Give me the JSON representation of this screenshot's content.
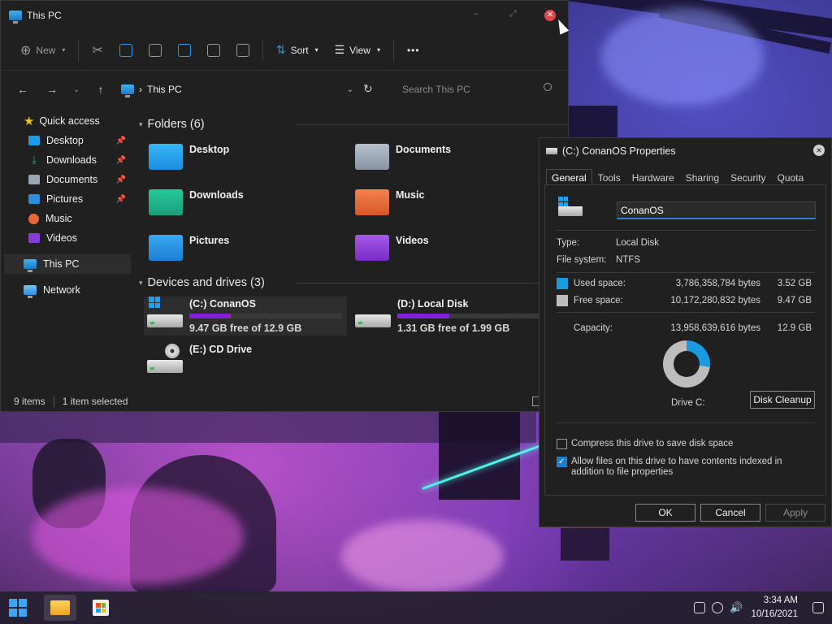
{
  "explorer": {
    "title": "This PC",
    "toolbar": {
      "new_label": "New",
      "sort_label": "Sort",
      "view_label": "View",
      "more_label": "•••"
    },
    "address": {
      "path": "This PC",
      "separator": "›"
    },
    "search": {
      "placeholder": "Search This PC"
    },
    "sidebar": {
      "quick_access": "Quick access",
      "items": [
        {
          "label": "Desktop",
          "icon": "desktop-folder-icon",
          "pinned": true
        },
        {
          "label": "Downloads",
          "icon": "downloads-folder-icon",
          "pinned": true
        },
        {
          "label": "Documents",
          "icon": "documents-folder-icon",
          "pinned": true
        },
        {
          "label": "Pictures",
          "icon": "pictures-folder-icon",
          "pinned": true
        },
        {
          "label": "Music",
          "icon": "music-folder-icon",
          "pinned": false
        },
        {
          "label": "Videos",
          "icon": "videos-folder-icon",
          "pinned": false
        }
      ],
      "this_pc": "This PC",
      "network": "Network"
    },
    "folders_header": "Folders (6)",
    "folders": [
      {
        "label": "Desktop",
        "color": "#1e9be8"
      },
      {
        "label": "Documents",
        "color": "#9aa6b4"
      },
      {
        "label": "Downloads",
        "color": "#1db38a"
      },
      {
        "label": "Music",
        "color": "#e8683a"
      },
      {
        "label": "Pictures",
        "color": "#2a8fe0"
      },
      {
        "label": "Videos",
        "color": "#8a3ad6"
      }
    ],
    "drives_header": "Devices and drives (3)",
    "drives": [
      {
        "name": "(C:) ConanOS",
        "free": "9.47 GB free of 12.9 GB",
        "used_fraction": 0.27
      },
      {
        "name": "(D:) Local Disk",
        "free": "1.31 GB free of 1.99 GB",
        "used_fraction": 0.34
      },
      {
        "name": "(E:) CD Drive",
        "free": "",
        "used_fraction": null
      }
    ],
    "status": {
      "items": "9 items",
      "selected": "1 item selected"
    }
  },
  "properties": {
    "title": "(C:) ConanOS Properties",
    "tabs": [
      "General",
      "Tools",
      "Hardware",
      "Sharing",
      "Security",
      "Quota"
    ],
    "volume_name": "ConanOS",
    "type_label": "Type:",
    "type_value": "Local Disk",
    "fs_label": "File system:",
    "fs_value": "NTFS",
    "used": {
      "label": "Used space:",
      "bytes": "3,786,358,784 bytes",
      "gb": "3.52 GB",
      "color": "#1a9ae0"
    },
    "free": {
      "label": "Free space:",
      "bytes": "10,172,280,832 bytes",
      "gb": "9.47 GB",
      "color": "#bdbdbd"
    },
    "capacity": {
      "label": "Capacity:",
      "bytes": "13,958,639,616 bytes",
      "gb": "12.9 GB"
    },
    "used_fraction": 0.27,
    "drive_label": "Drive C:",
    "cleanup_label": "Disk Cleanup",
    "compress_label": "Compress this drive to save disk space",
    "compress_checked": false,
    "index_label": "Allow files on this drive to have contents indexed in addition to file properties",
    "index_checked": true,
    "ok_label": "OK",
    "cancel_label": "Cancel",
    "apply_label": "Apply"
  },
  "taskbar": {
    "time": "3:34 AM",
    "date": "10/16/2021"
  }
}
